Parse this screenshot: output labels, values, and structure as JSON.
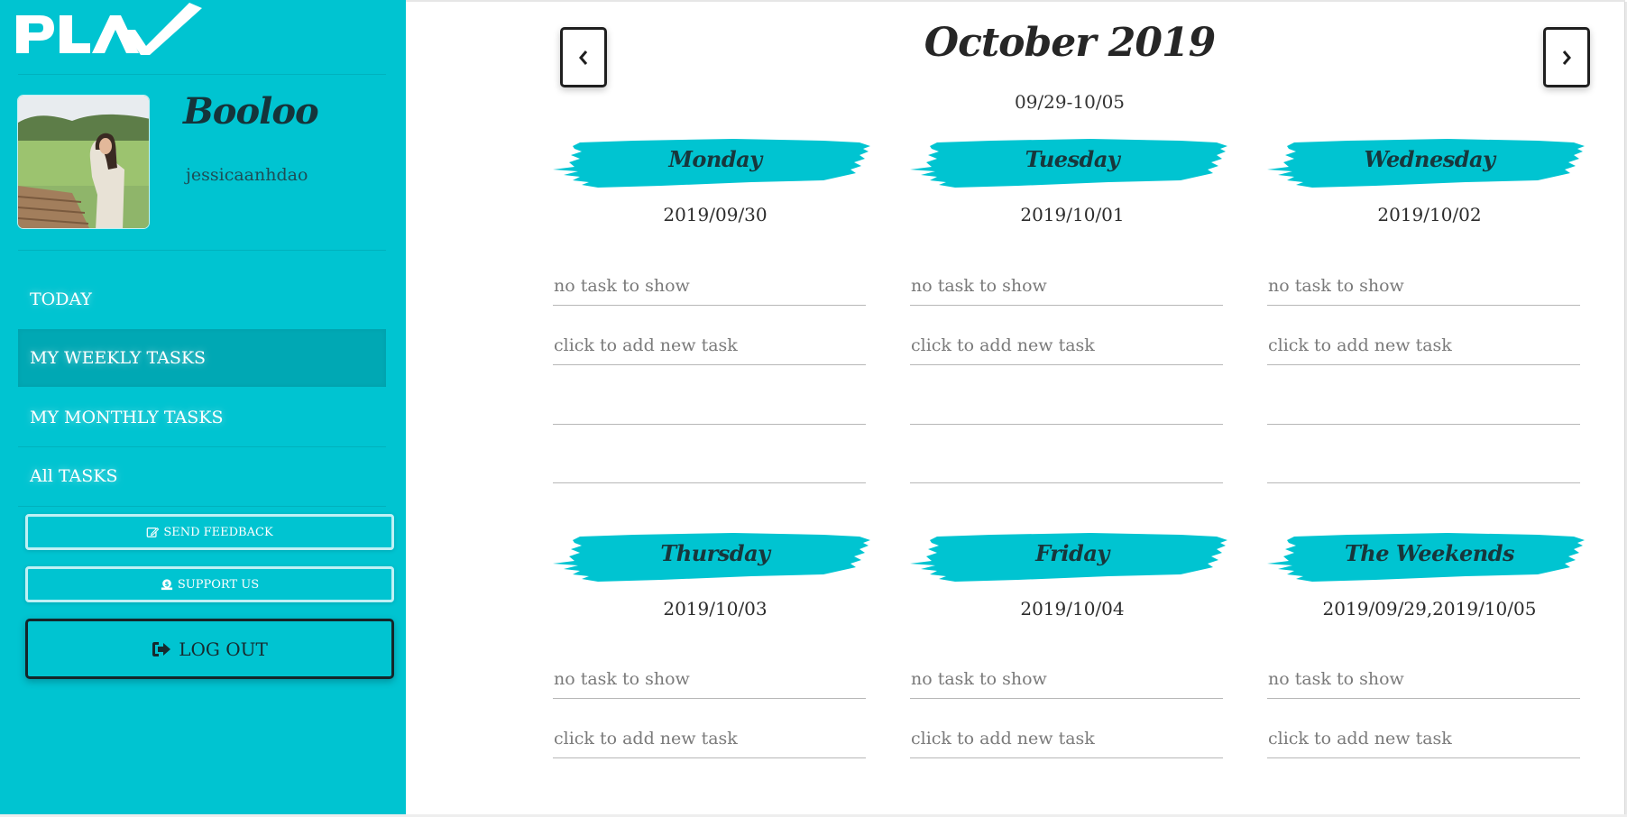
{
  "app": {
    "logo_text": "PLAN",
    "brand_color": "#00c4d1",
    "active_nav_color": "#00a8b4"
  },
  "profile": {
    "display_name": "Booloo",
    "username": "jessicaanhdao",
    "avatar_alt": "profile photo"
  },
  "sidebar": {
    "nav": [
      {
        "label": "TODAY",
        "active": false
      },
      {
        "label": "MY WEEKLY TASKS",
        "active": true
      },
      {
        "label": "MY MONTHLY TASKS",
        "active": false
      },
      {
        "label": "All TASKS",
        "active": false
      }
    ],
    "feedback_label": "SEND FEEDBACK",
    "feedback_icon": "edit-icon",
    "support_label": "SUPPORT US",
    "support_icon": "donate-icon",
    "logout_label": "LOG OUT",
    "logout_icon": "sign-out-icon"
  },
  "header": {
    "title": "October 2019",
    "range": "09/29-10/05",
    "prev_icon": "chevron-left-icon",
    "next_icon": "chevron-right-icon"
  },
  "days": [
    {
      "name": "Monday",
      "date": "2019/09/30",
      "empty_text": "no task to show",
      "add_text": "click to add new task"
    },
    {
      "name": "Tuesday",
      "date": "2019/10/01",
      "empty_text": "no task to show",
      "add_text": "click to add new task"
    },
    {
      "name": "Wednesday",
      "date": "2019/10/02",
      "empty_text": "no task to show",
      "add_text": "click to add new task"
    },
    {
      "name": "Thursday",
      "date": "2019/10/03",
      "empty_text": "no task to show",
      "add_text": "click to add new task"
    },
    {
      "name": "Friday",
      "date": "2019/10/04",
      "empty_text": "no task to show",
      "add_text": "click to add new task"
    },
    {
      "name": "The Weekends",
      "date": "2019/09/29,2019/10/05",
      "empty_text": "no task to show",
      "add_text": "click to add new task"
    }
  ]
}
